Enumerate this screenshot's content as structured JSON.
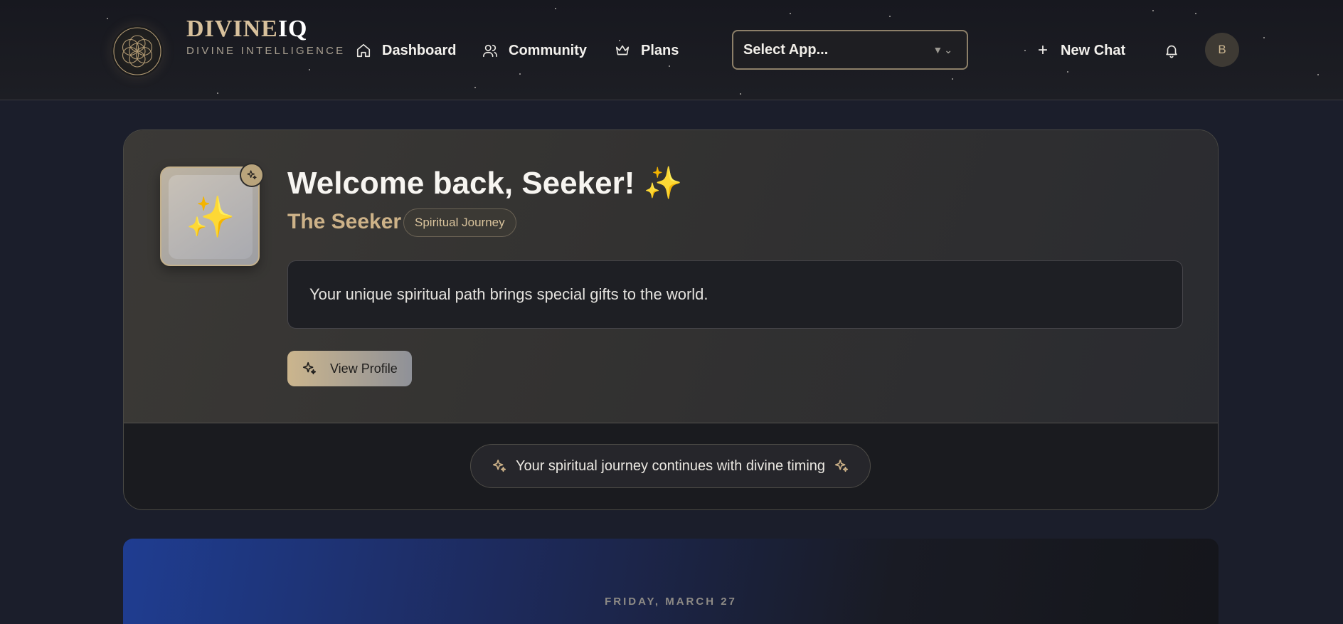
{
  "header": {
    "brand_name_main": "DIVINE",
    "brand_name_accent": "IQ",
    "brand_tagline": "DIVINE INTELLIGENCE",
    "nav": [
      {
        "label": "Dashboard",
        "icon": "home-icon"
      },
      {
        "label": "Community",
        "icon": "users-icon"
      },
      {
        "label": "Plans",
        "icon": "crown-icon"
      }
    ],
    "app_select_value": "Select App...",
    "new_chat_label": "New Chat",
    "avatar_initial": "B"
  },
  "welcome": {
    "title": "Welcome back, Seeker! ✨",
    "role_name": "The Seeker",
    "role_badge": "Spiritual Journey",
    "avatar_emoji": "✨",
    "message": "Your unique spiritual path brings special gifts to the world.",
    "view_profile_label": "View Profile",
    "journey_note": "Your spiritual journey continues with divine timing"
  },
  "date_card": {
    "date_label": "FRIDAY, MARCH 27"
  },
  "colors": {
    "background": "#1b1e2b",
    "gold_accent": "#cdb288",
    "card": "#333231",
    "date_card_blue": "#1f3d91"
  }
}
